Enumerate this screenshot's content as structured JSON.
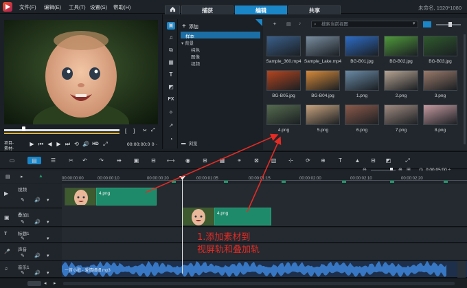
{
  "app": {
    "resolution_label": "未命名, 1920*1080"
  },
  "menu": [
    "文件(F)",
    "编辑(E)",
    "工具(T)",
    "设置(S)",
    "帮助(H)"
  ],
  "tabs": [
    "捕获",
    "编辑",
    "共享"
  ],
  "preview": {
    "timecode": "00:00:00:0 0 ·",
    "project_label": "项目-",
    "clip_label": "素材-",
    "hd_label": "HD"
  },
  "tree": {
    "add_label": "添加",
    "items": [
      "样本",
      "背景",
      "纯色",
      "图像",
      "视频"
    ],
    "browse_label": "浏览"
  },
  "library": {
    "search_placeholder": "搜索当前视图",
    "items": [
      {
        "label": "Sample_360.mp4",
        "color": "#3a5f8a"
      },
      {
        "label": "Sample_Lake.mp4",
        "color": "#7a8ea0"
      },
      {
        "label": "BG-B01.jpg",
        "color": "#2d6cc6"
      },
      {
        "label": "BG-B02.jpg",
        "color": "#4f9a3a"
      },
      {
        "label": "BG-B03.jpg",
        "color": "#2f5a2c"
      },
      {
        "label": "BG-B05.jpg",
        "color": "#b5451f"
      },
      {
        "label": "BG-B04.jpg",
        "color": "#d68a3a"
      },
      {
        "label": "1.png",
        "color": "#6a8aa5"
      },
      {
        "label": "2.png",
        "color": "#b7a493"
      },
      {
        "label": "3.png",
        "color": "#9a7a6a"
      },
      {
        "label": "4.png",
        "color": "#556b4e"
      },
      {
        "label": "5.png",
        "color": "#c7a37d"
      },
      {
        "label": "6.png",
        "color": "#8b5a4a"
      },
      {
        "label": "7.png",
        "color": "#a08a80"
      },
      {
        "label": "8.png",
        "color": "#c49aa0"
      }
    ]
  },
  "ruler": [
    "00:00:00:00",
    "00:00:00:10",
    "00:00:00:20",
    "00:00:01:05",
    "00:00:01:15",
    "00:00:02:00",
    "00:00:02:10",
    "00:00:02:20"
  ],
  "zoom_timecode": "0:00:05:00 ÷",
  "tracks": [
    {
      "name": "视频"
    },
    {
      "name": "叠加1"
    },
    {
      "name": "标题1"
    },
    {
      "name": "声音"
    },
    {
      "name": "音乐1"
    }
  ],
  "clips": {
    "video": "4.png",
    "overlay": "4.png",
    "music": "一首小歌 - 爱情细细.mp3"
  },
  "annotation": {
    "line1": "1.添加素材到",
    "line2": "视屏轨和叠加轨"
  },
  "colors": {
    "accent": "#1a86c8",
    "clip": "#1f8a6a",
    "arrow": "#e52b24",
    "waveform": "#3b7fd0"
  }
}
